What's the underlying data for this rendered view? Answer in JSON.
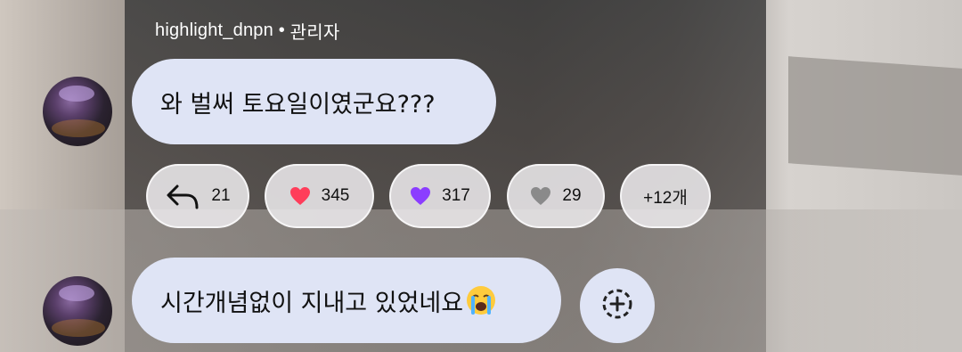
{
  "header": {
    "username": "highlight_dnpn",
    "separator": "•",
    "role": "관리자"
  },
  "messages": [
    {
      "text": "와 벌써 토요일이였군요???"
    },
    {
      "text": "시간개념없이 지내고 있었네요"
    }
  ],
  "reactions": [
    {
      "icon": "reply-icon",
      "count": "21"
    },
    {
      "icon": "red-heart-icon",
      "count": "345",
      "color": "#ff3d5a"
    },
    {
      "icon": "purple-heart-icon",
      "count": "317",
      "color": "#8b3dff"
    },
    {
      "icon": "grey-heart-icon",
      "count": "29",
      "color": "#8a8a8a"
    },
    {
      "label": "+12개"
    }
  ],
  "actions": {
    "add_reaction_icon": "add-reaction-icon"
  }
}
